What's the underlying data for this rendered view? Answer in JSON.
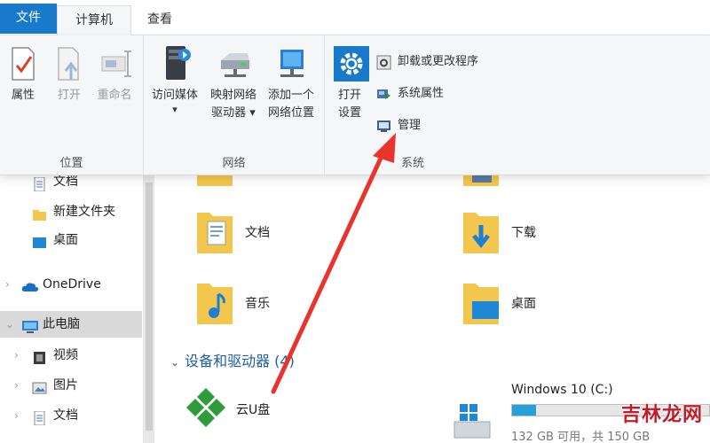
{
  "tabs": {
    "file": "文件",
    "computer": "计算机",
    "view": "查看"
  },
  "ribbon": {
    "location": {
      "label": "位置",
      "properties": "属性",
      "open": "打开",
      "rename": "重命名"
    },
    "network": {
      "label": "网络",
      "access_media_1": "访问媒体",
      "access_media_2": "▾",
      "map_drive_1": "映射网络",
      "map_drive_2": "驱动器 ▾",
      "add_location_1": "添加一个",
      "add_location_2": "网络位置"
    },
    "system": {
      "label": "系统",
      "open_settings_1": "打开",
      "open_settings_2": "设置",
      "uninstall": "卸载或更改程序",
      "system_properties": "系统属性",
      "manage": "管理"
    }
  },
  "nav": {
    "items": [
      {
        "label": "文档"
      },
      {
        "label": "新建文件夹"
      },
      {
        "label": "桌面"
      },
      {
        "label": "OneDrive"
      },
      {
        "label": "此电脑"
      },
      {
        "label": "视频"
      },
      {
        "label": "图片"
      },
      {
        "label": "文档"
      }
    ]
  },
  "content": {
    "folders": [
      {
        "label": "文档"
      },
      {
        "label": "下载"
      },
      {
        "label": "音乐"
      },
      {
        "label": "桌面"
      }
    ],
    "devices_section": "设备和驱动器 (4)",
    "devices": [
      {
        "label": "云U盘"
      },
      {
        "label": "Windows 10 (C:)",
        "space": "132 GB 可用，共 150 GB",
        "used_fraction": 0.12
      }
    ]
  },
  "watermark": "吉林龙网",
  "colors": {
    "accent": "#1979ca",
    "folder": "#f3c74d",
    "annotation_arrow": "#e8342d"
  }
}
